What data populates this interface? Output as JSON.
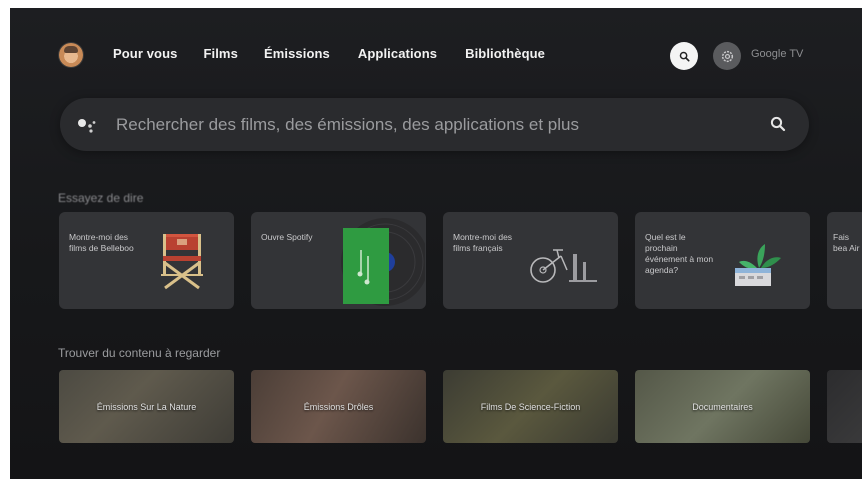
{
  "nav": {
    "items": [
      {
        "label": "Pour vous"
      },
      {
        "label": "Films"
      },
      {
        "label": "Émissions"
      },
      {
        "label": "Applications"
      },
      {
        "label": "Bibliothèque"
      }
    ],
    "brand": "Google TV"
  },
  "search": {
    "placeholder": "Rechercher des films, des émissions, des applications et plus"
  },
  "sections": {
    "suggestions_title": "Essayez de dire",
    "browse_title": "Trouver du contenu à regarder"
  },
  "suggestions": [
    {
      "text": "Montre-moi des films de Belleboo",
      "icon": "directors-chair-icon"
    },
    {
      "text": "Ouvre Spotify",
      "icon": "spotify-record-icon"
    },
    {
      "text": "Montre-moi des films français",
      "icon": "bicycle-icon"
    },
    {
      "text": "Quel est le prochain événement à mon agenda?",
      "icon": "calendar-plant-icon"
    },
    {
      "text": "Fais bea Air",
      "icon": "partial-card"
    }
  ],
  "categories": [
    {
      "label": "Émissions Sur La Nature"
    },
    {
      "label": "Émissions Drôles"
    },
    {
      "label": "Films De Science-Fiction"
    },
    {
      "label": "Documentaires"
    },
    {
      "label": ""
    }
  ],
  "colors": {
    "background": "#17181a",
    "card": "#333437",
    "searchbar": "#2a2b2e",
    "accent_green": "#2f9b41",
    "director_chair_red": "#b94131"
  }
}
